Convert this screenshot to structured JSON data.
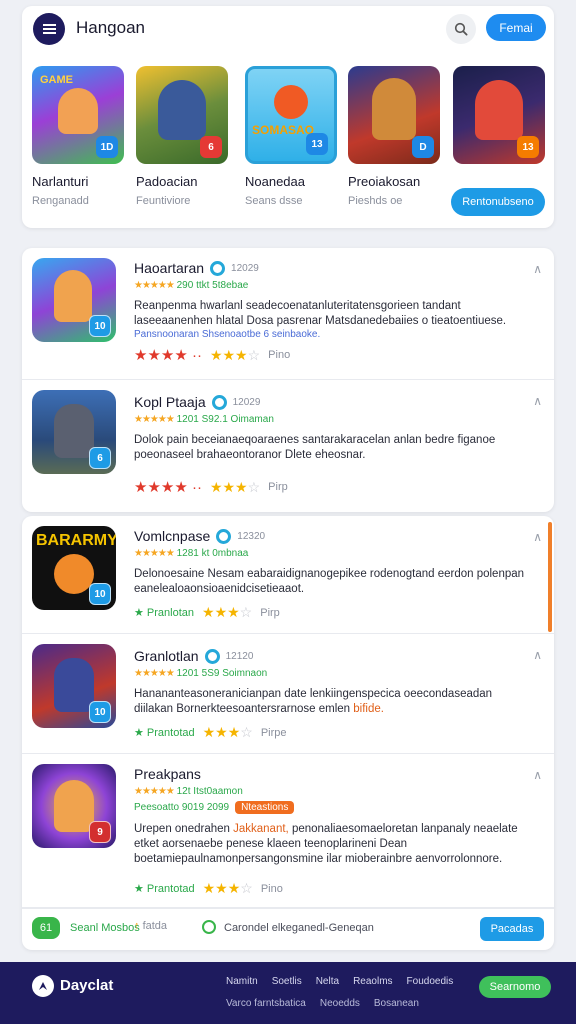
{
  "header": {
    "title": "Hangoan",
    "action": "Femai"
  },
  "featured": [
    {
      "name": "Narlanturi",
      "sub": "Renganadd",
      "badge": "1D",
      "badge_color": "#1e88e5"
    },
    {
      "name": "Padoacian",
      "sub": "Feuntiviore",
      "badge": "6",
      "badge_color": "#e53935"
    },
    {
      "name": "Noanedaa",
      "sub": "Seans dsse",
      "badge": "13",
      "badge_color": "#1e88e5"
    },
    {
      "name": "Preoiakosan",
      "sub": "Pieshds oe",
      "badge": "D",
      "badge_color": "#1e88e5"
    },
    {
      "name": "",
      "sub": "",
      "badge": "13",
      "badge_color": "#f57c00"
    }
  ],
  "featured_cta": "Rentonubseno",
  "apps": [
    {
      "title": "Haoartaran",
      "count": "12029",
      "stats": "290 ttkt 5t8ebae",
      "desc": "Reanpenma hwarlanl seadecoenatanluteritatensgorieen tandant laseeaanenhen hlatal Dosa pasrenar Matsdanedebaiies o tieatoentiuese.",
      "tags": "Pansnoonaran Shsenoaotbe 6 seinbaoke.",
      "foot_label": "Pino",
      "badge": "10"
    },
    {
      "title": "Kopl Ptaaja",
      "count": "12029",
      "stats": "1201 S92.1 Oimaman",
      "desc": "Dolok pain beceianaeqoaraenes santarakaracelan anlan bedre figanoe poeonaseel brahaeontoranor Dlete eheosnar.",
      "tags": "",
      "foot_label": "Pirp",
      "badge": "6"
    },
    {
      "title": "Vomlcnpase",
      "count": "12320",
      "stats": "1281 kt 0mbnaa",
      "desc": "Delonoesaine Nesam eabaraidignanogepikee rodenogtand eerdon polenpan eanelealoaonsioaenidcisetieaaot.",
      "tags": "",
      "green_tag": "Pranlotan",
      "foot_label": "Pirp",
      "badge": "10"
    },
    {
      "title": "Granlotlan",
      "count": "12120",
      "stats": "1201 5S9 Soimnaon",
      "desc": "Hanananteasoneranicianpan date lenkiingenspecica oeecondaseadan diilakan Bornerkteesoantersrarnose emlen",
      "highlight": "bifide.",
      "tags": "",
      "green_tag": "Prantotad",
      "foot_label": "Pirpe",
      "badge": "10"
    },
    {
      "title": "Preakpans",
      "count": "",
      "stats": "12t Itst0aamon",
      "stats2": "Peesoatto 9019 2099",
      "promo": "Nteastions",
      "desc_a": "Urepen onedrahen",
      "desc_hl": "Jakkanant,",
      "desc_b": "penonaliaesomaeloretan lanpanaly neaelate etket aorsenaebe penese klaeen teenoplarineni Dean boetamiepaulnamonpersangonsmine ilar mioberainbre aenvorrolonnore.",
      "green_tag": "Prantotad",
      "foot_label": "Pino",
      "badge": "9"
    }
  ],
  "bottom_strip": {
    "pill": "61",
    "text1": "Seanl Mosbos",
    "text2": "fatda",
    "text3": "Carondel elkeganedl-Geneqan",
    "button": "Pacadas"
  },
  "footer": {
    "brand": "Dayclat",
    "links": [
      "Namitn",
      "Soetlis",
      "Nelta",
      "Reaolms",
      "Foudoedis"
    ],
    "links2": [
      "Varco farntsbatica",
      "Neoedds",
      "Bosanean"
    ],
    "button": "Searnomo"
  }
}
